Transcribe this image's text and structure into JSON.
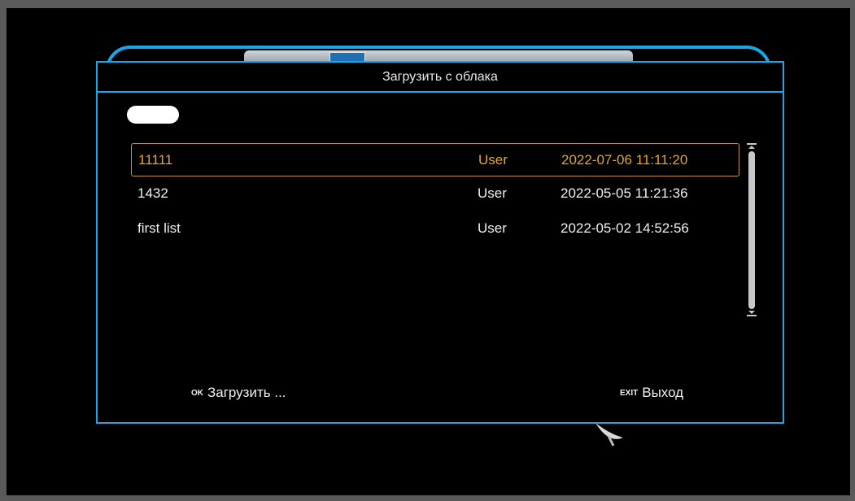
{
  "dialog": {
    "title": "Загрузить с облака"
  },
  "list": {
    "rows": [
      {
        "name": "11111",
        "owner": "User",
        "date": "2022-07-06 11:11:20",
        "selected": true
      },
      {
        "name": "1432",
        "owner": "User",
        "date": "2022-05-05 11:21:36",
        "selected": false
      },
      {
        "name": "first list",
        "owner": "User",
        "date": "2022-05-02 14:52:56",
        "selected": false
      }
    ]
  },
  "footer": {
    "ok_key": "OK",
    "ok_label": "Загрузить ...",
    "exit_key": "EXIT",
    "exit_label": "Выход"
  },
  "colors": {
    "border": "#19a9e8",
    "selected_text": "#e7a728",
    "selected_border": "#c69a2a"
  }
}
